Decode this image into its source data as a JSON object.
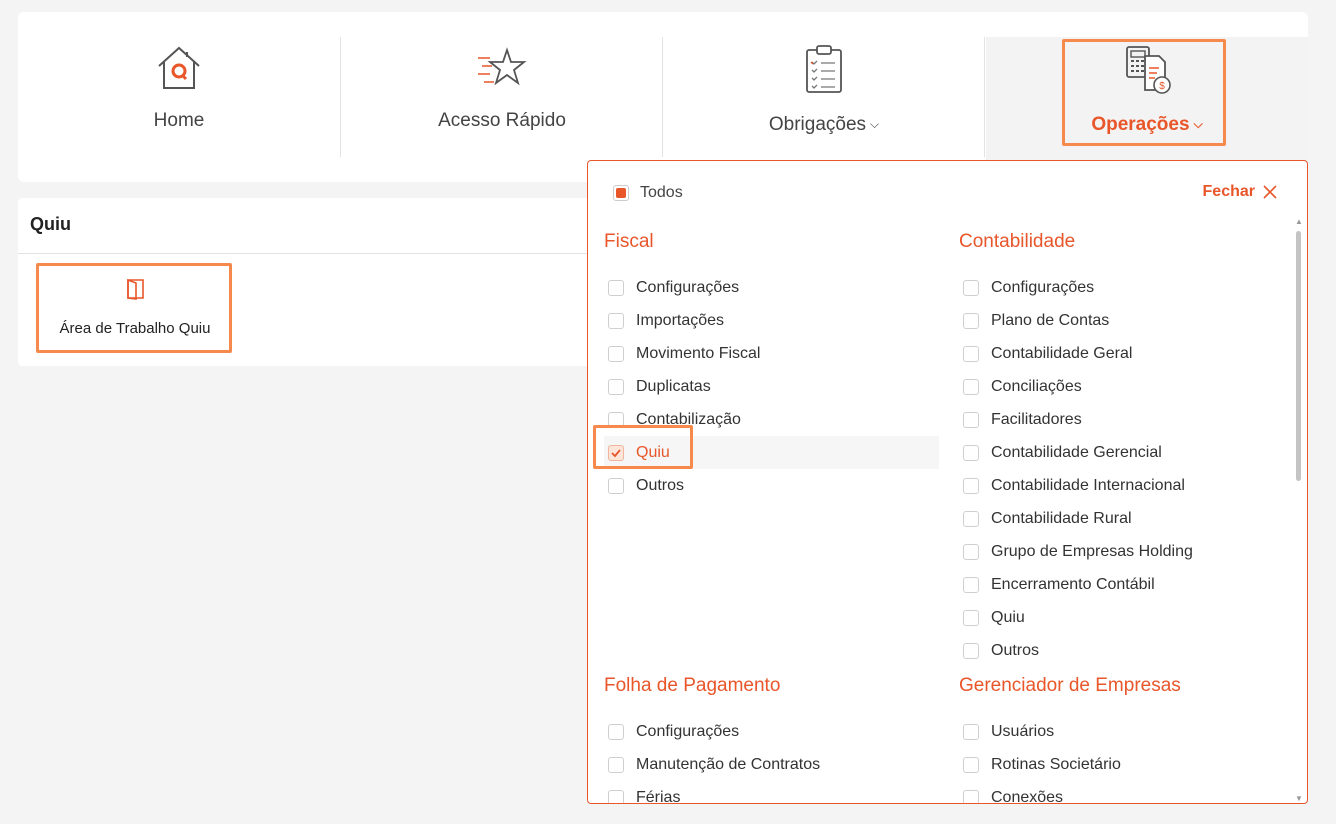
{
  "nav": {
    "items": [
      {
        "label": "Home",
        "icon": "home-icon"
      },
      {
        "label": "Acesso Rápido",
        "icon": "star-icon"
      },
      {
        "label": "Obrigações",
        "icon": "clipboard-icon"
      },
      {
        "label": "Operações",
        "icon": "operations-icon"
      }
    ],
    "chevron": "⌵"
  },
  "quiu_panel": {
    "title": "Quiu",
    "card_label": "Área de Trabalho Quiu"
  },
  "dropdown": {
    "todos_label": "Todos",
    "close_label": "Fechar",
    "sections": [
      {
        "title": "Fiscal",
        "items": [
          "Configurações",
          "Importações",
          "Movimento Fiscal",
          "Duplicatas",
          "Contabilização",
          "Quiu",
          "Outros"
        ],
        "selected_index": 5
      },
      {
        "title": "Contabilidade",
        "items": [
          "Configurações",
          "Plano de Contas",
          "Contabilidade Geral",
          "Conciliações",
          "Facilitadores",
          "Contabilidade Gerencial",
          "Contabilidade Internacional",
          "Contabilidade Rural",
          "Grupo de Empresas Holding",
          "Encerramento Contábil",
          "Quiu",
          "Outros"
        ]
      },
      {
        "title": "Folha de Pagamento",
        "items": [
          "Configurações",
          "Manutenção de Contratos",
          "Férias"
        ]
      },
      {
        "title": "Gerenciador de Empresas",
        "items": [
          "Usuários",
          "Rotinas Societário",
          "Conexões"
        ]
      }
    ]
  },
  "colors": {
    "accent": "#e8562a",
    "highlight": "#f58a4c"
  }
}
